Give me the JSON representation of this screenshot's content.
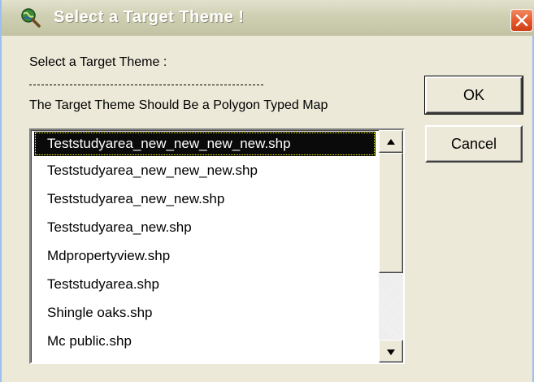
{
  "window": {
    "title": "Select a Target Theme !"
  },
  "colors": {
    "titlebar": "#cfcfb3",
    "close_button": "#e4572b",
    "selection": "#0a0a0a",
    "dialog_background": "#ece9d8"
  },
  "icons": {
    "app": "globe-magnifier-icon",
    "close": "close-icon",
    "scroll_up": "arrow-up-icon",
    "scroll_down": "arrow-down-icon"
  },
  "instructions": {
    "prompt": "Select a Target Theme :",
    "note": "The Target Theme Should Be a Polygon Typed Map"
  },
  "theme_list": {
    "selected_index": 0,
    "items": [
      "Teststudyarea_new_new_new_new.shp",
      "Teststudyarea_new_new_new.shp",
      "Teststudyarea_new_new.shp",
      "Teststudyarea_new.shp",
      "Mdpropertyview.shp",
      "Teststudyarea.shp",
      "Shingle oaks.shp",
      "Mc public.shp"
    ]
  },
  "buttons": {
    "ok_label": "OK",
    "cancel_label": "Cancel"
  }
}
